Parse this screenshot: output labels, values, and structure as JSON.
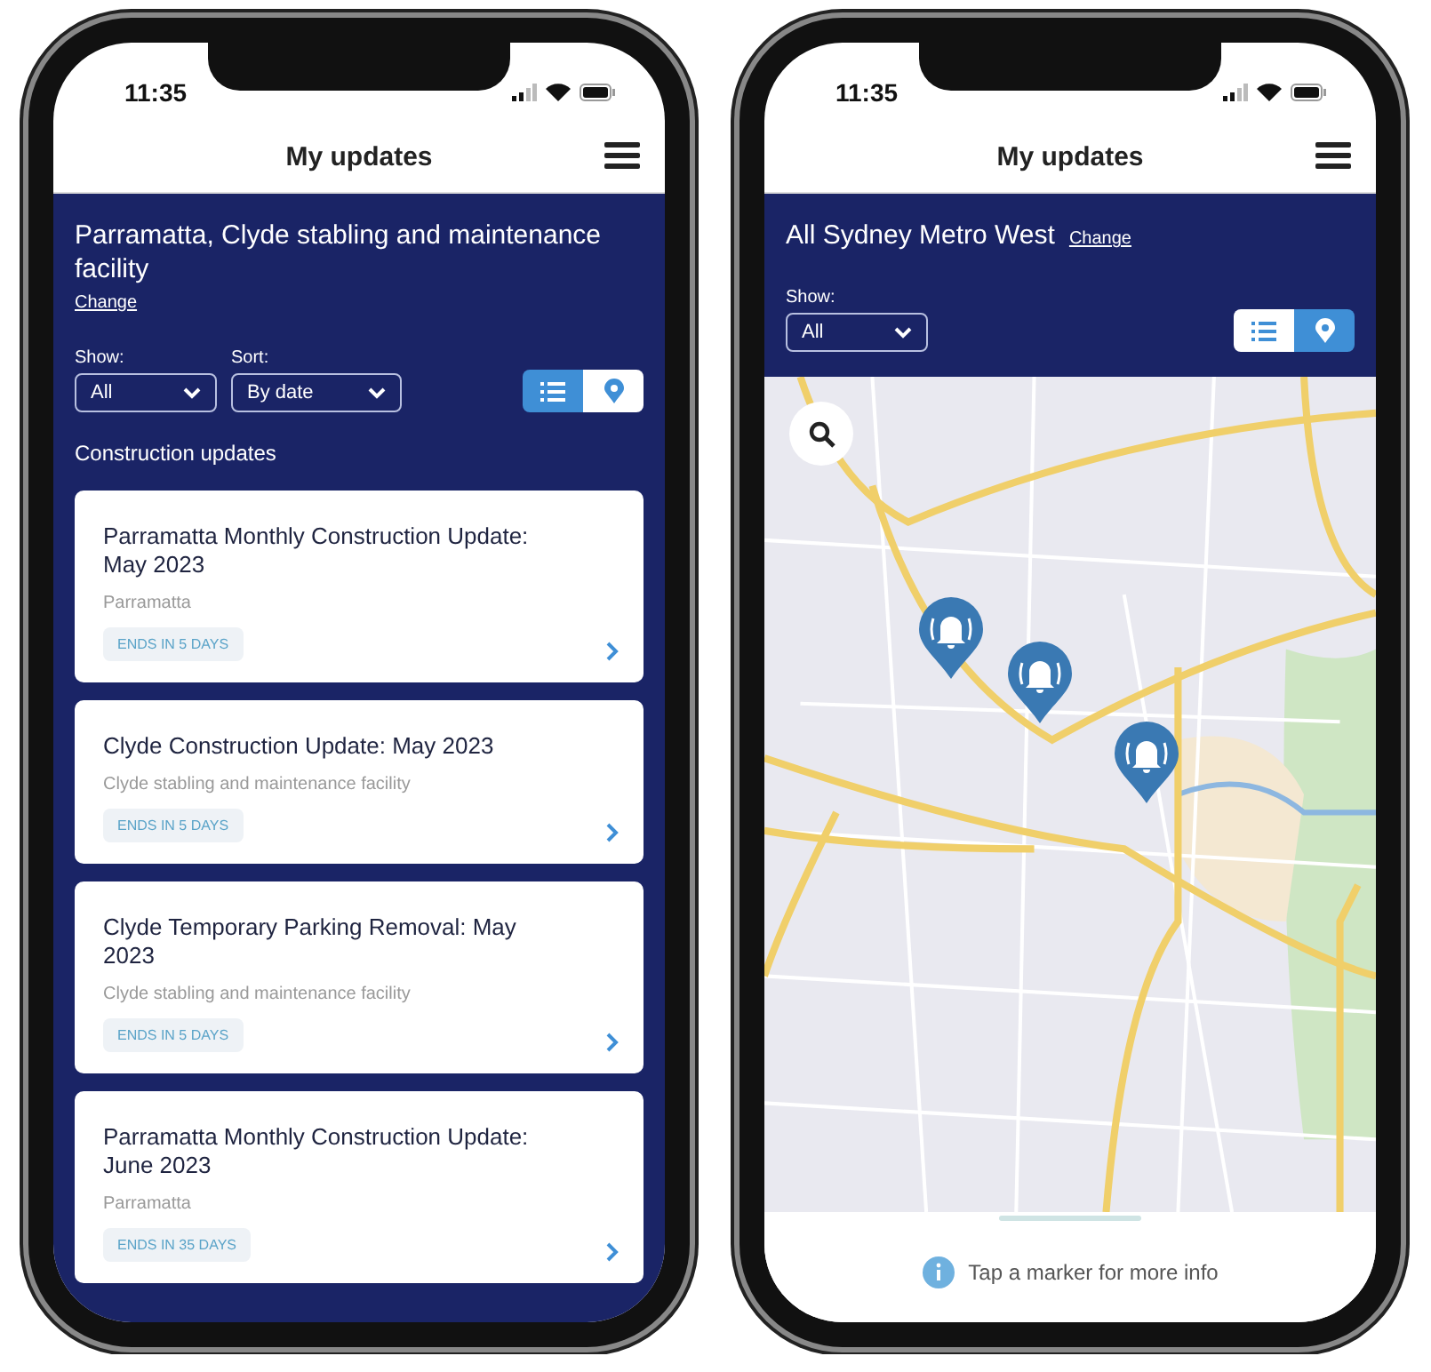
{
  "phones": [
    {
      "kind": "list",
      "time": "11:35",
      "title": "My updates",
      "location": "Parramatta, Clyde stabling and maintenance facility",
      "change_link": "Change",
      "filters": [
        {
          "label": "Show:",
          "value": "All"
        },
        {
          "label": "Sort:",
          "value": "By date"
        }
      ],
      "view_toggle": [
        {
          "kind": "list",
          "selected": true
        },
        {
          "kind": "map",
          "selected": false
        }
      ],
      "section_title": "Construction updates",
      "cards": [
        {
          "title": "Parramatta Monthly Construction Update: May 2023",
          "location": "Parramatta",
          "badge": "ENDS IN 5 DAYS"
        },
        {
          "title": "Clyde Construction Update: May 2023",
          "location": "Clyde stabling and maintenance facility",
          "badge": "ENDS IN 5 DAYS"
        },
        {
          "title": "Clyde Temporary Parking Removal: May 2023",
          "location": "Clyde stabling and maintenance facility",
          "badge": "ENDS IN 5 DAYS"
        },
        {
          "title": "Parramatta Monthly Construction Update: June 2023",
          "location": "Parramatta",
          "badge": "ENDS IN 35 DAYS"
        }
      ]
    },
    {
      "kind": "map",
      "time": "11:35",
      "title": "My updates",
      "location": "All Sydney Metro West",
      "change_link": "Change",
      "filters": [
        {
          "label": "Show:",
          "value": "All"
        }
      ],
      "view_toggle": [
        {
          "kind": "list",
          "selected": false
        },
        {
          "kind": "map",
          "selected": true
        }
      ],
      "hint": "Tap a marker for more info"
    }
  ]
}
